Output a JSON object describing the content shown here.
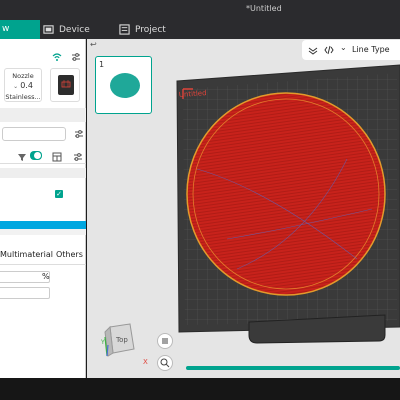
{
  "window": {
    "title": "*Untitled"
  },
  "tabs": {
    "prepare": "w",
    "device": "Device",
    "project": "Project"
  },
  "printer": {
    "nozzle_label": "Nozzle",
    "nozzle_value": "0.4",
    "nozzle_material": "Stainless..."
  },
  "settings_tabs": {
    "multimaterial": "Multimaterial",
    "others": "Others"
  },
  "fields": {
    "percent_unit": "%"
  },
  "plates": [
    {
      "number": "1"
    }
  ],
  "view_toolbar": {
    "line_type_label": "Line Type"
  },
  "plate_label": "Untitled",
  "cube": {
    "face_label": "Top",
    "axis_y": "Y",
    "axis_x": "X"
  },
  "colors": {
    "accent": "#00a38e",
    "highlight": "#00a7e0",
    "bed": "#3a3a3a",
    "print": "#c8221b"
  }
}
